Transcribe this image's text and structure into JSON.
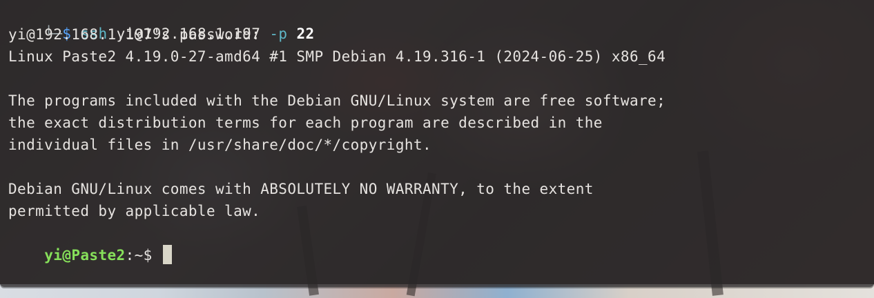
{
  "terminal": {
    "command_line": {
      "frame": "└─",
      "prompt_symbol": "$",
      "command": "ssh",
      "target": "yi@192.168.1.197",
      "flag": "-p",
      "port": "22"
    },
    "output": [
      "yi@192.168.1.197's password:",
      "Linux Paste2 4.19.0-27-amd64 #1 SMP Debian 4.19.316-1 (2024-06-25) x86_64",
      "",
      "The programs included with the Debian GNU/Linux system are free software;",
      "the exact distribution terms for each program are described in the",
      "individual files in /usr/share/doc/*/copyright.",
      "",
      "Debian GNU/Linux comes with ABSOLUTELY NO WARRANTY, to the extent",
      "permitted by applicable law."
    ],
    "prompt": {
      "user_host": "yi@Paste2",
      "separator": ":",
      "path": "~",
      "symbol": "$"
    }
  },
  "colors": {
    "command": "#5fb8c8",
    "user_host": "#86e05a",
    "prompt_symbol": "#58a6ff",
    "text": "#e6e3e0",
    "cursor": "#d9d6c8"
  }
}
